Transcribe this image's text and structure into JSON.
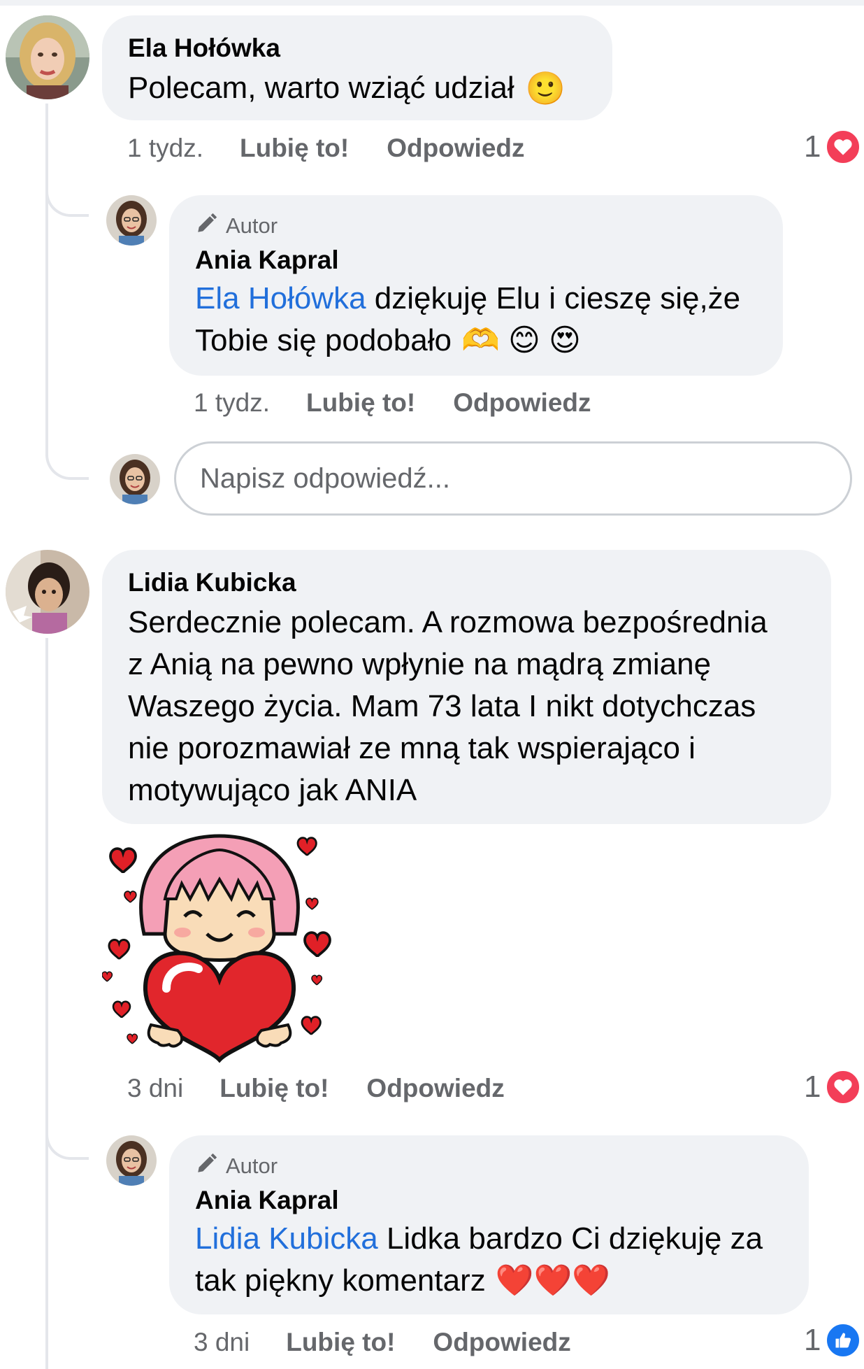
{
  "comments": [
    {
      "author": "Ela Hołówka",
      "text": "Polecam, warto wziąć udział",
      "emoji": "🙂",
      "time": "1 tydz.",
      "like_label": "Lubię to!",
      "reply_label": "Odpowiedz",
      "reaction_count": "1",
      "reaction_icon": "heart-reaction-icon",
      "replies": [
        {
          "badge": "Autor",
          "author": "Ania Kapral",
          "mention": "Ela Hołówka",
          "text_line1": " dziękuję Elu i cieszę się,że",
          "text_line2": "Tobie się podobało",
          "emojis": "🫶 😊 😍",
          "time": "1 tydz.",
          "like_label": "Lubię to!",
          "reply_label": "Odpowiedz"
        }
      ],
      "reply_box_placeholder": "Napisz odpowiedź..."
    },
    {
      "author": "Lidia Kubicka",
      "text_lines": [
        "Serdecznie polecam. A rozmowa  bezpośrednia",
        "z Anią  na pewno wpłynie na mądrą zmianę",
        "Waszego życia. Mam 73 lata I nikt dotychczas",
        "nie porozmawiał ze mną tak wspierająco i",
        "motywująco  jak ANIA"
      ],
      "sticker": "girl-hugging-heart-sticker",
      "time": "3 dni",
      "like_label": "Lubię to!",
      "reply_label": "Odpowiedz",
      "reaction_count": "1",
      "reaction_icon": "heart-reaction-icon",
      "replies": [
        {
          "badge": "Autor",
          "author": "Ania Kapral",
          "mention": "Lidia Kubicka",
          "text_line1": " Lidka bardzo Ci dziękuję za",
          "text_line2": "tak piękny komentarz",
          "emojis": "❤️❤️❤️",
          "time": "3 dni",
          "like_label": "Lubię to!",
          "reply_label": "Odpowiedz",
          "reaction_count": "1",
          "reaction_icon": "thumbs-up-reaction-icon"
        }
      ]
    }
  ],
  "colors": {
    "bubble": "#f0f2f5",
    "mention": "#216fdb",
    "meta_text": "#65676b",
    "heart_reaction": "#f33e58",
    "like_reaction": "#1877f2"
  }
}
